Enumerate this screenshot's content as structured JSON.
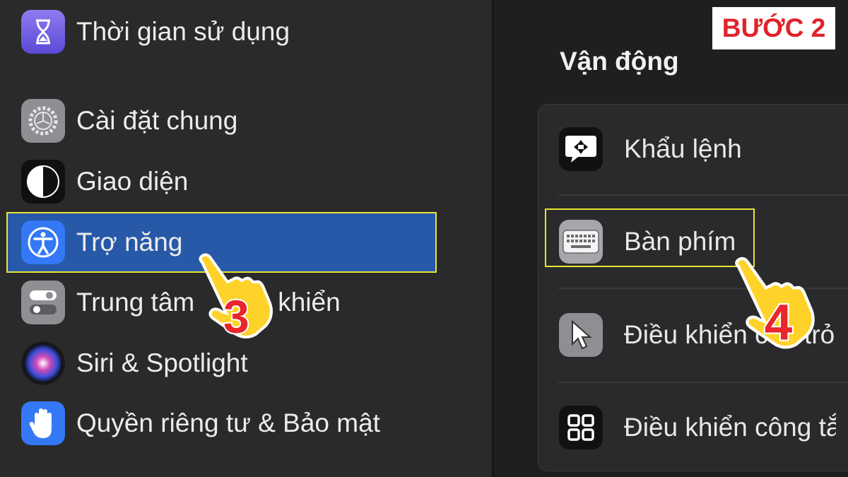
{
  "step_badge": "BƯỚC 2",
  "sidebar": {
    "items": [
      {
        "label": "Thời gian sử dụng",
        "icon": "hourglass-icon"
      },
      {
        "label": "Cài đặt chung",
        "icon": "gear-icon"
      },
      {
        "label": "Giao diện",
        "icon": "appearance-icon"
      },
      {
        "label": "Trợ năng",
        "icon": "accessibility-icon",
        "selected": true
      },
      {
        "label": "Trung tâm",
        "label_tail": "khiển",
        "icon": "control-center-icon"
      },
      {
        "label": "Siri & Spotlight",
        "icon": "siri-icon"
      },
      {
        "label": "Quyền riêng tư & Bảo mật",
        "icon": "hand-icon"
      }
    ]
  },
  "content": {
    "section_title": "Vận động",
    "items": [
      {
        "label": "Khẩu lệnh",
        "icon": "voice-control-icon"
      },
      {
        "label": "Bàn phím",
        "icon": "keyboard-icon"
      },
      {
        "label": "Điều khiển con trỏ",
        "icon": "pointer-icon"
      },
      {
        "label": "Điều khiển công tắc",
        "icon": "switch-control-icon"
      }
    ]
  },
  "annotations": {
    "step_3": "3",
    "step_4": "4"
  },
  "colors": {
    "selection": "#2759a8",
    "highlight_border": "#e9e436",
    "step_number": "#e8262c",
    "badge_text": "#e0232a"
  }
}
